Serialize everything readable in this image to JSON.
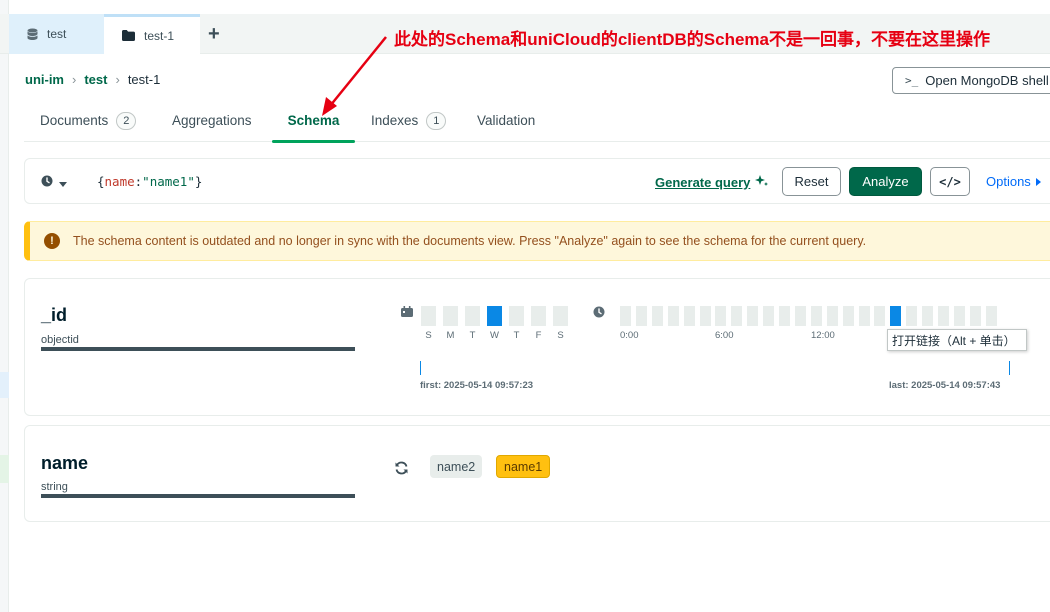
{
  "tabs": [
    {
      "label": "test",
      "icon": "database-icon"
    },
    {
      "label": "test-1",
      "icon": "folder-icon"
    }
  ],
  "add_tab": "+",
  "annotation": "此处的Schema和uniCloud的clientDB的Schema不是一回事，不要在这里操作",
  "breadcrumb": {
    "cluster": "uni-im",
    "database": "test",
    "collection": "test-1"
  },
  "open_shell": {
    "label": "Open MongoDB shell",
    "icon_text": ">_"
  },
  "subtabs": [
    {
      "label": "Documents",
      "count": "2"
    },
    {
      "label": "Aggregations"
    },
    {
      "label": "Schema"
    },
    {
      "label": "Indexes",
      "count": "1"
    },
    {
      "label": "Validation"
    }
  ],
  "query": {
    "open": "{",
    "key": "name",
    "colon": ":",
    "value": "\"name1\"",
    "close": "}"
  },
  "buttons": {
    "generate_query": "Generate query",
    "reset": "Reset",
    "analyze": "Analyze",
    "code": "</>",
    "options": "Options"
  },
  "warning": "The schema content is outdated and no longer in sync with the documents view. Press \"Analyze\" again to see the schema for the current query.",
  "fields": [
    {
      "name": "_id",
      "type": "objectid",
      "days": [
        "S",
        "M",
        "T",
        "W",
        "T",
        "F",
        "S"
      ],
      "highlight_day": 3,
      "hour_labels": [
        "0:00",
        "6:00",
        "12:00"
      ],
      "highlight_hour": 17,
      "first": "first: 2025-05-14 09:57:23",
      "last": "last: 2025-05-14 09:57:43",
      "tooltip": "打开链接（Alt + 单击）"
    },
    {
      "name": "name",
      "type": "string",
      "values": [
        "name2",
        "name1"
      ]
    }
  ],
  "colors": {
    "accent": "#00684a",
    "highlight": "#0a88e5",
    "warning": "#ffc010",
    "annotation": "#e60012"
  }
}
